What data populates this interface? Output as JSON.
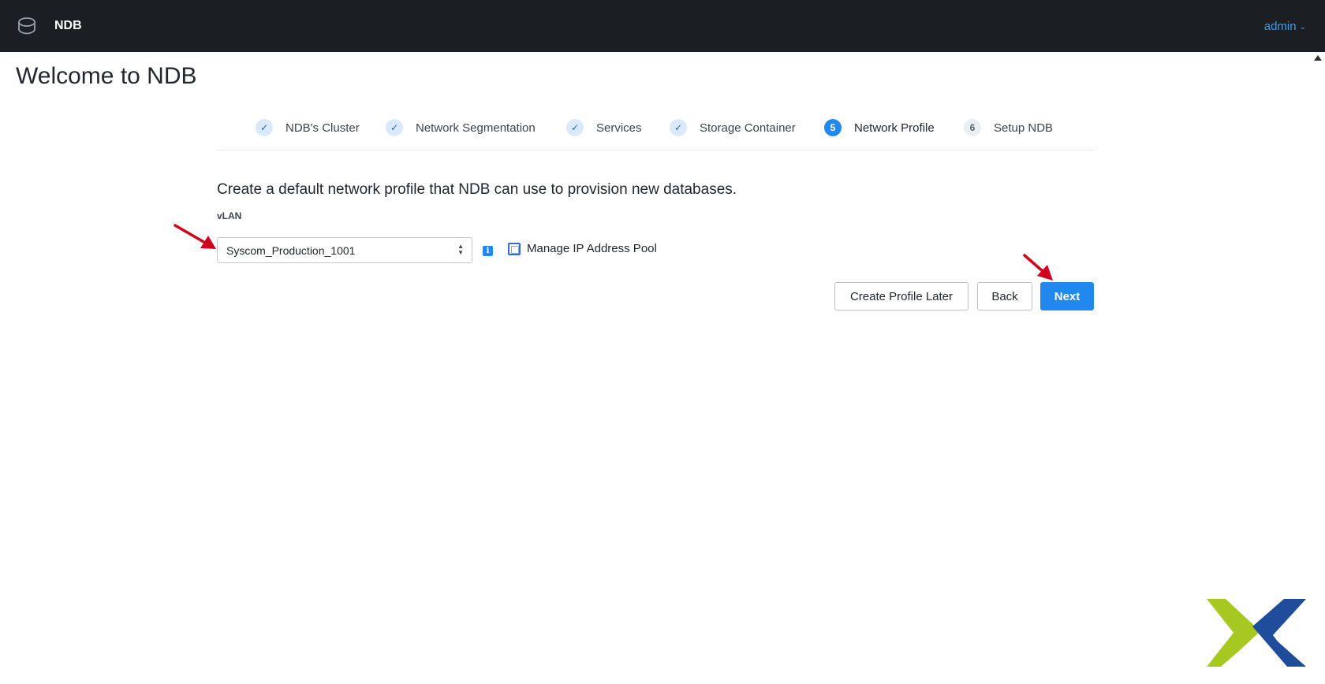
{
  "header": {
    "app_name": "NDB",
    "user_menu": "admin",
    "user_menu_chevron": "⌄",
    "colors": {
      "background": "#1b1e22",
      "accent": "#3e9df0"
    }
  },
  "page": {
    "title": "Welcome to NDB"
  },
  "wizard": {
    "steps": [
      {
        "label": "NDB's Cluster",
        "marker": "✓",
        "state": "done"
      },
      {
        "label": "Network Segmentation",
        "marker": "✓",
        "state": "done"
      },
      {
        "label": "Services",
        "marker": "✓",
        "state": "done"
      },
      {
        "label": "Storage Container",
        "marker": "✓",
        "state": "done"
      },
      {
        "label": "Network Profile",
        "marker": "5",
        "state": "active"
      },
      {
        "label": "Setup NDB",
        "marker": "6",
        "state": "pending"
      }
    ]
  },
  "form": {
    "description": "Create a default network profile that NDB can use to provision new databases.",
    "vlan_label": "vLAN",
    "vlan_value": "Syscom_Production_1001",
    "info_icon_glyph": "i",
    "manage_ip_pool_label": "Manage IP Address Pool",
    "manage_ip_pool_checked": false
  },
  "actions": {
    "create_later": "Create Profile Later",
    "back": "Back",
    "next": "Next"
  },
  "colors": {
    "primary": "#2188f0",
    "annotation_arrow": "#d0021b",
    "logo_green": "#a6c820",
    "logo_blue": "#1f4d9c"
  }
}
